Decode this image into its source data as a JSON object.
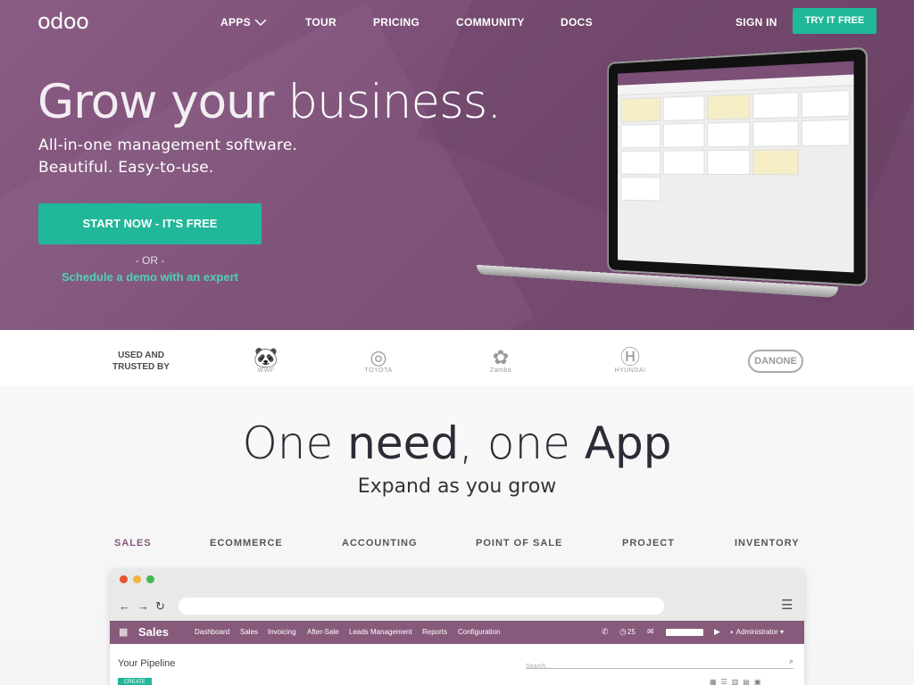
{
  "brand": "odoo",
  "nav": {
    "apps": "APPS",
    "tour": "TOUR",
    "pricing": "PRICING",
    "community": "COMMUNITY",
    "docs": "DOCS",
    "sign_in": "SIGN IN",
    "try_free": "TRY IT FREE"
  },
  "hero": {
    "headline_a": "Grow your ",
    "headline_b": "business",
    "headline_c": ".",
    "sub1": "All-in-one management software.",
    "sub2": "Beautiful. Easy-to-use.",
    "cta": "START NOW - IT'S FREE",
    "or": "- OR -",
    "demo": "Schedule a demo with an expert"
  },
  "trusted": {
    "label": "USED AND TRUSTED BY",
    "brands": [
      "WWF",
      "TOYOTA",
      "Zamba",
      "HYUNDAI",
      "DANONE"
    ]
  },
  "section": {
    "title_a": "One ",
    "title_b": "need",
    "title_c": ", one ",
    "title_d": "App",
    "subtitle": "Expand as you grow"
  },
  "tabs": [
    "SALES",
    "ECOMMERCE",
    "ACCOUNTING",
    "POINT OF SALE",
    "PROJECT",
    "INVENTORY"
  ],
  "active_tab": "SALES",
  "app": {
    "title": "Sales",
    "menu": [
      "Dashboard",
      "Sales",
      "Invoicing",
      "After-Sale",
      "Leads Management",
      "Reports",
      "Configuration"
    ],
    "count": "25",
    "user": "Administrator",
    "breadcrumb": "Your Pipeline",
    "search_placeholder": "Search...",
    "create": "CREATE"
  },
  "colors": {
    "primary": "#875a7b",
    "accent": "#21b799"
  }
}
